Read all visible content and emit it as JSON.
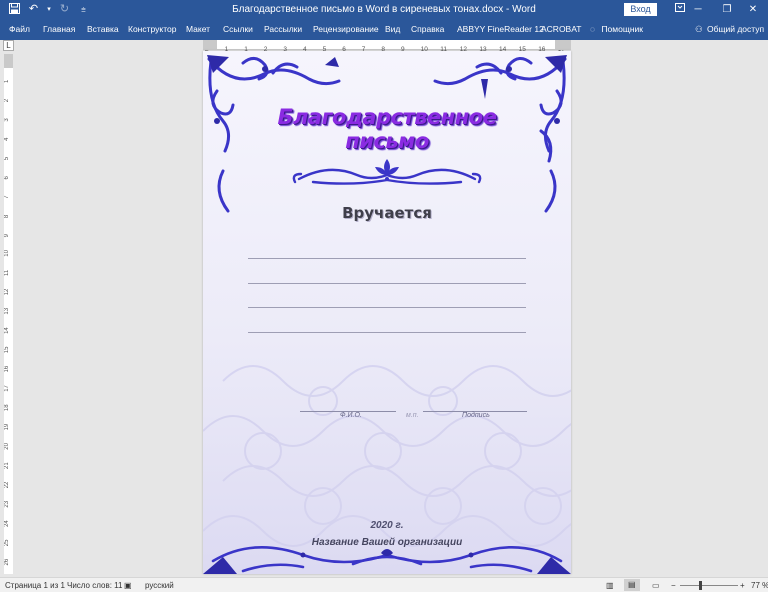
{
  "titlebar": {
    "title": "Благодарственное письмо в Word в сиреневых тонах.docx  -  Word",
    "login_label": "Вход",
    "qat_save_icon": "save-icon",
    "qat_undo_icon": "undo-icon",
    "qat_redo_icon": "redo-icon",
    "qat_more_icon": "customize-qat-icon"
  },
  "ribbon": {
    "tabs": [
      "Файл",
      "Главная",
      "Вставка",
      "Конструктор",
      "Макет",
      "Ссылки",
      "Рассылки",
      "Рецензирование",
      "Вид",
      "Справка",
      "ABBYY FineReader 12",
      "ACROBAT"
    ],
    "helper_label": "Помощник",
    "share_label": "Общий доступ"
  },
  "document": {
    "heading": "Благодарственное письмо",
    "awarded": "Вручается",
    "fio_label": "Ф.И.О.",
    "mp_label": "м.п.",
    "signature_label": "Подпись",
    "year": "2020 г.",
    "org": "Название Вашей организации"
  },
  "statusbar": {
    "page_info": "Страница 1 из 1",
    "word_count": "Число слов: 11",
    "language": "русский",
    "zoom": "77 %"
  },
  "ruler": {
    "numbers": [
      "2",
      "1",
      "1",
      "2",
      "3",
      "4",
      "5",
      "6",
      "7",
      "8",
      "9",
      "10",
      "11",
      "12",
      "13",
      "14",
      "15",
      "16",
      "17",
      "18"
    ],
    "vnumbers": [
      "1",
      "2",
      "3",
      "4",
      "5",
      "6",
      "7",
      "8",
      "9",
      "10",
      "11",
      "12",
      "13",
      "14",
      "15",
      "16",
      "17",
      "18",
      "19",
      "20",
      "21",
      "22",
      "23",
      "24",
      "25",
      "26"
    ],
    "corner": "L"
  }
}
